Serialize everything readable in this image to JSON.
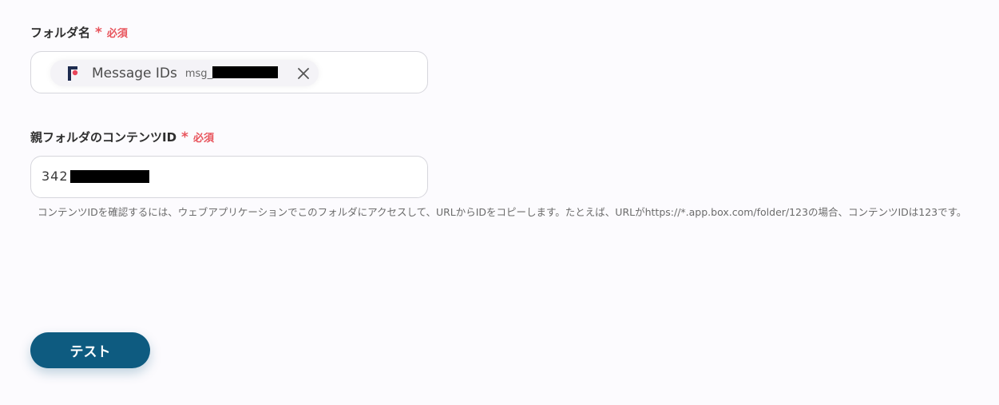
{
  "folder_name": {
    "label": "フォルダ名",
    "required_star": "*",
    "required_text": "必須",
    "chip": {
      "icon": "app-logo-icon",
      "label": "Message IDs",
      "value_prefix": "msg_"
    }
  },
  "parent_folder": {
    "label": "親フォルダのコンテンツID",
    "required_star": "*",
    "required_text": "必須",
    "value_prefix": "342",
    "help": "コンテンツIDを確認するには、ウェブアプリケーションでこのフォルダにアクセスして、URLからIDをコピーします。たとえば、URLがhttps://*.app.box.com/folder/123の場合、コンテンツIDは123です。"
  },
  "test_button": {
    "label": "テスト"
  },
  "colors": {
    "required": "#e8545c",
    "primary": "#0e5b80",
    "background": "#fcfbfe"
  }
}
